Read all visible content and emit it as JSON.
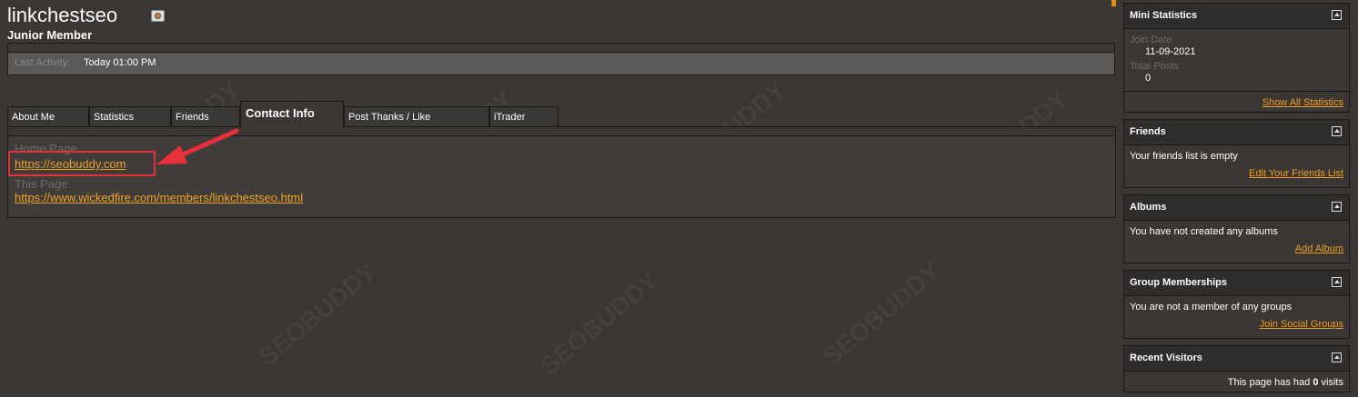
{
  "profile": {
    "username": "linkchestseo",
    "usertitle": "Junior Member",
    "last_activity_label": "Last Activity:",
    "last_activity_value": "Today 01:00 PM"
  },
  "tabs": [
    {
      "label": "About Me"
    },
    {
      "label": "Statistics"
    },
    {
      "label": "Friends"
    },
    {
      "label": "Contact Info",
      "active": true
    },
    {
      "label": "Post Thanks / Like"
    },
    {
      "label": "iTrader"
    }
  ],
  "contact": {
    "home_page_label": "Home Page",
    "home_page_url": "https://seobuddy.com",
    "this_page_label": "This Page",
    "this_page_url": "https://www.wickedfire.com/members/linkchestseo.html"
  },
  "sidebar": {
    "mini_stats": {
      "title": "Mini Statistics",
      "join_date_label": "Join Date",
      "join_date_value": "11-09-2021",
      "total_posts_label": "Total Posts",
      "total_posts_value": "0",
      "link": "Show All Statistics"
    },
    "friends": {
      "title": "Friends",
      "body": "Your friends list is empty",
      "link": "Edit Your Friends List"
    },
    "albums": {
      "title": "Albums",
      "body": "You have not created any albums",
      "link": "Add Album"
    },
    "groups": {
      "title": "Group Memberships",
      "body": "You are not a member of any groups",
      "link": "Join Social Groups"
    },
    "visitors": {
      "title": "Recent Visitors",
      "body_prefix": "This page has had",
      "count": "0",
      "body_suffix": "visits"
    }
  },
  "watermark": "SEOBUDDY",
  "colors": {
    "link": "#f0a020",
    "annotation": "#e8303a",
    "background": "#393634"
  }
}
